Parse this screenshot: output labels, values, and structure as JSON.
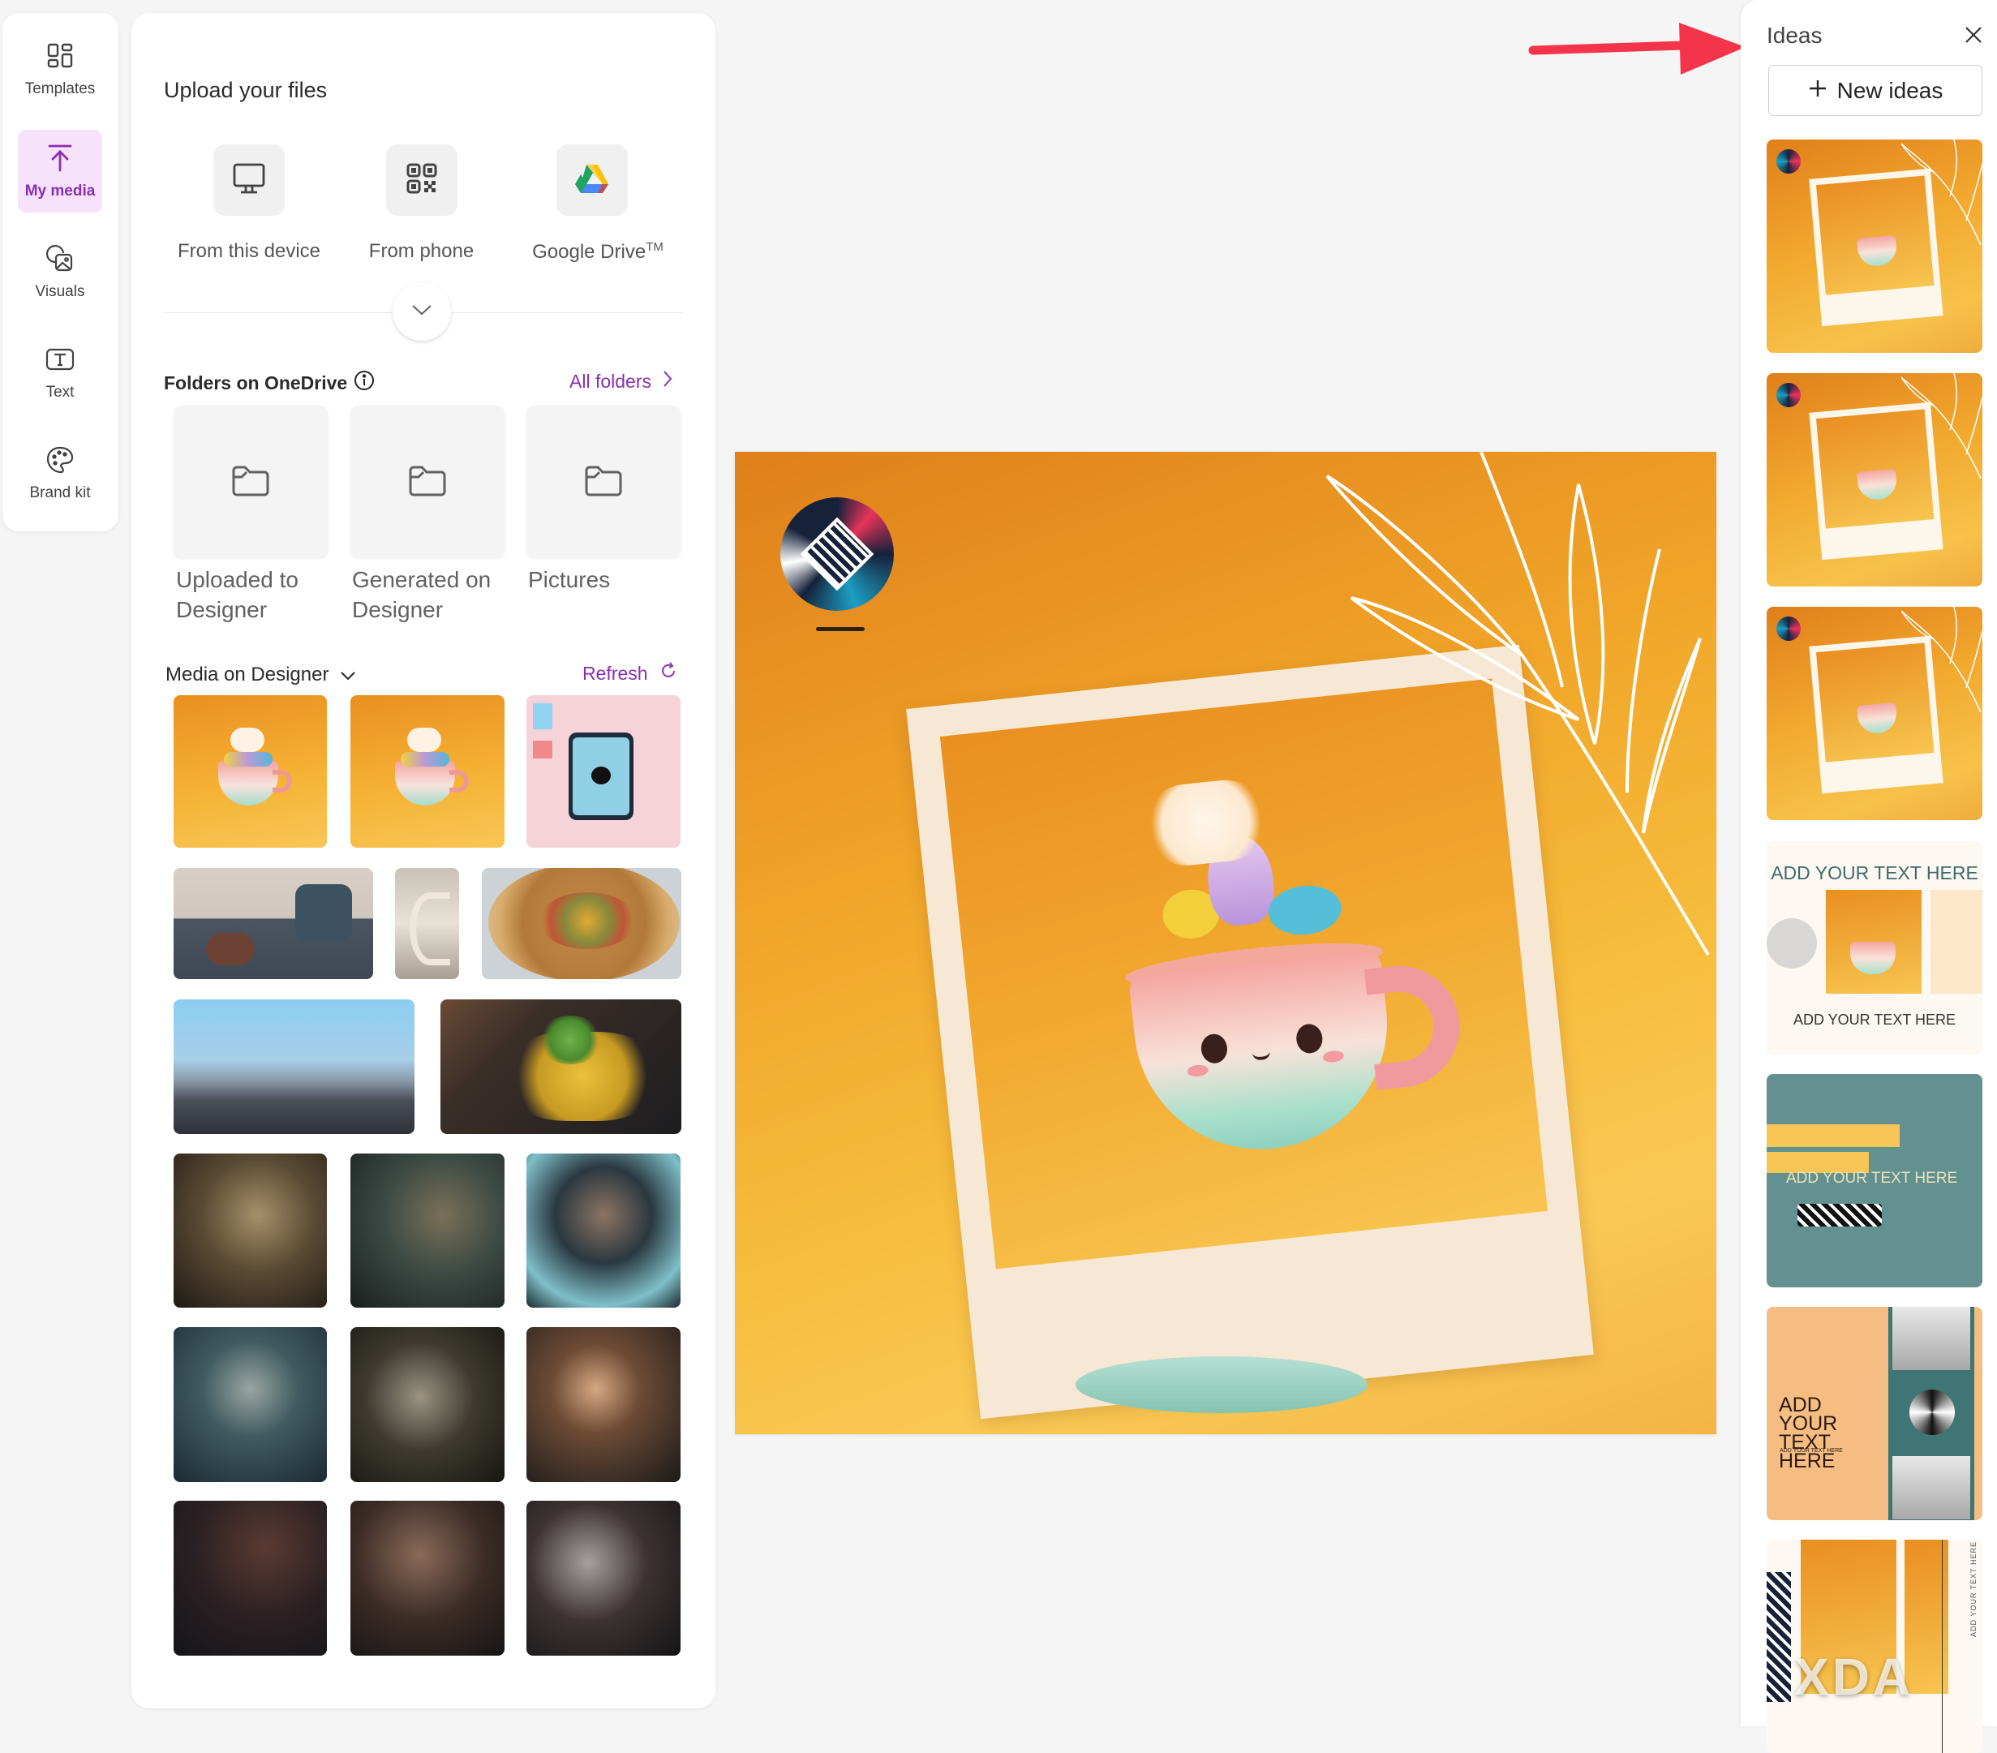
{
  "rail": {
    "items": [
      {
        "label": "Templates",
        "icon": "templates-icon",
        "active": false
      },
      {
        "label": "My media",
        "icon": "upload-icon",
        "active": true
      },
      {
        "label": "Visuals",
        "icon": "visuals-icon",
        "active": false
      },
      {
        "label": "Text",
        "icon": "text-icon",
        "active": false
      },
      {
        "label": "Brand kit",
        "icon": "palette-icon",
        "active": false
      }
    ]
  },
  "media_panel": {
    "upload_title": "Upload your files",
    "upload_sources": [
      {
        "label": "From this device",
        "icon": "monitor-icon"
      },
      {
        "label": "From phone",
        "icon": "qr-code-icon"
      },
      {
        "label": "Google Drive",
        "label_sup": "TM",
        "icon": "google-drive-icon"
      }
    ],
    "folders_title": "Folders on OneDrive",
    "all_folders_label": "All folders",
    "folders": [
      {
        "line1": "Uploaded to",
        "line2": "Designer"
      },
      {
        "line1": "Generated on",
        "line2": "Designer"
      },
      {
        "line1": "Pictures",
        "line2": ""
      }
    ],
    "media_title": "Media on Designer",
    "refresh_label": "Refresh",
    "media_items": [
      {
        "subject": "kawaii teacup on orange background"
      },
      {
        "subject": "kawaii teacup on orange background"
      },
      {
        "subject": "tablet flat-lay on pink desk"
      },
      {
        "subject": "child lying on sofa in living room"
      },
      {
        "subject": "spiral staircase"
      },
      {
        "subject": "vegetable pizza"
      },
      {
        "subject": "sky over beach horizon"
      },
      {
        "subject": "plated dish with microgreens"
      },
      {
        "subject": "cat behind magnifying glass"
      },
      {
        "subject": "cat with binoculars"
      },
      {
        "subject": "cat in hood behind keyboard"
      },
      {
        "subject": "cat in goggles"
      },
      {
        "subject": "cat with telescope"
      },
      {
        "subject": "cat through lens"
      },
      {
        "subject": "cat resting on keyboard"
      },
      {
        "subject": "cat close-up over keyboard"
      },
      {
        "subject": "cat on laptop keyboard"
      }
    ]
  },
  "canvas": {
    "background": "#f0a428",
    "description": "Polaroid frame with kawaii teacup, circuit logo badge and white plant line art"
  },
  "ideas": {
    "title": "Ideas",
    "new_ideas_label": "New ideas",
    "cards": [
      {
        "style": "polaroid-amber"
      },
      {
        "style": "polaroid-amber"
      },
      {
        "style": "polaroid-amber"
      },
      {
        "style": "collage-cream",
        "text_top": "ADD YOUR TEXT HERE",
        "text_bottom": "ADD YOUR TEXT HERE"
      },
      {
        "style": "teal-strips",
        "text": "ADD YOUR TEXT HERE"
      },
      {
        "style": "peach-teal",
        "headline": "ADD YOUR TEXT HERE",
        "subtext": "ADD YOUR TEXT HERE"
      },
      {
        "style": "cream-vertical",
        "vertical_text": "ADD YOUR TEXT HERE"
      }
    ]
  },
  "annotation": {
    "arrow_color": "#f3344a"
  },
  "watermark": {
    "text": "XDA"
  },
  "colors": {
    "accent": "#8a2fb3",
    "active_bg": "#f6e3fb",
    "canvas_orange": "#f0a428",
    "teal": "#63918f",
    "peach": "#f5bd82"
  }
}
